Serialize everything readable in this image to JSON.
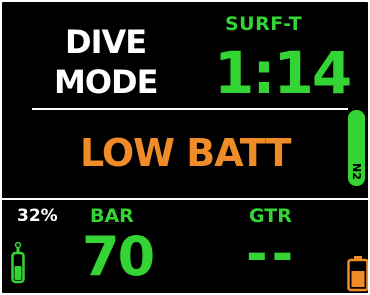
{
  "mode": {
    "line1": "DIVE",
    "line2": "MODE"
  },
  "surface_time": {
    "label": "SURF-T",
    "value": "1:14"
  },
  "alarm": {
    "text": "LOW BATT",
    "color": "#f08c28"
  },
  "n2_gauge": {
    "label": "N2",
    "color": "#35d435"
  },
  "tank": {
    "percent": "32%",
    "unit_label": "BAR",
    "pressure": "70",
    "icon": "gas-tank-icon"
  },
  "gtr": {
    "label": "GTR",
    "value": "--"
  },
  "battery": {
    "icon": "battery-icon",
    "color": "#f08c28"
  },
  "colors": {
    "background": "#000000",
    "primary_green": "#35d435",
    "warning_orange": "#f08c28",
    "text_white": "#ffffff"
  }
}
